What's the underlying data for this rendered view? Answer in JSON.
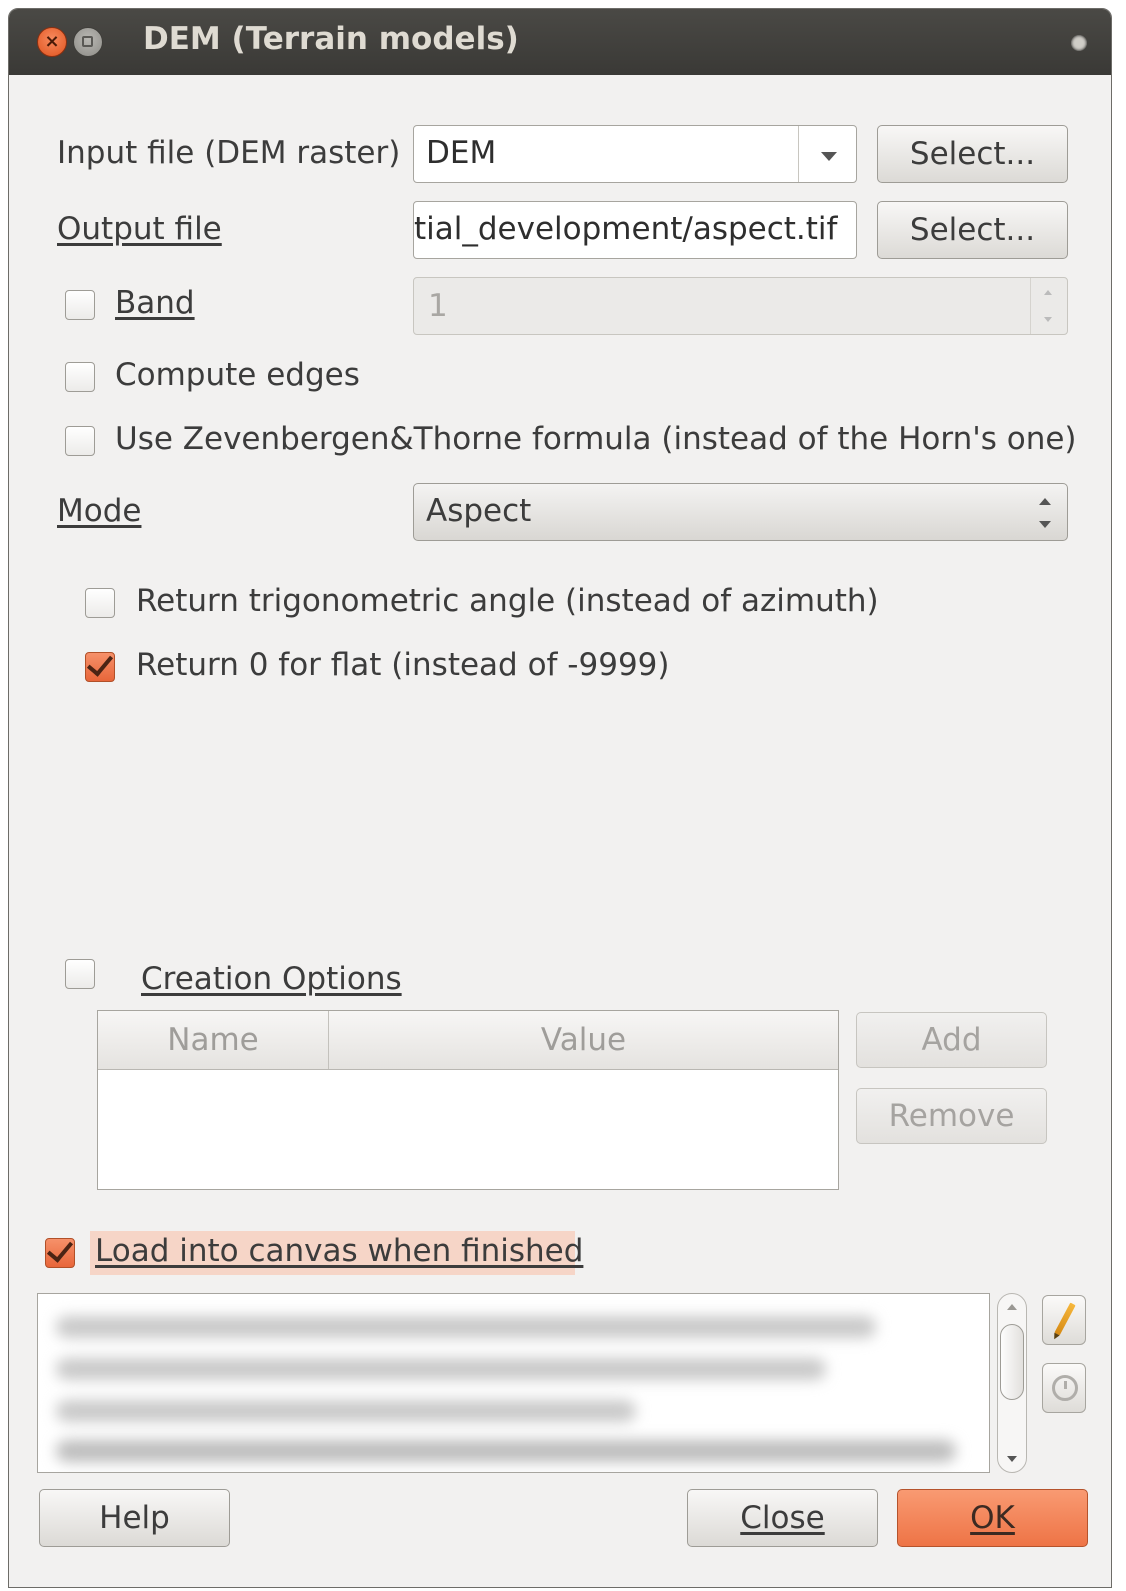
{
  "window": {
    "title": "DEM (Terrain models)",
    "close_glyph": "×"
  },
  "input_file": {
    "label": "Input file (DEM raster)",
    "value": "DEM",
    "select_label": "Select..."
  },
  "output_file": {
    "label": "Output file",
    "value": "tial_development/aspect.tif",
    "select_label": "Select..."
  },
  "band": {
    "label": "Band",
    "checked": false,
    "value": "1"
  },
  "compute_edges": {
    "label": "Compute edges",
    "checked": false
  },
  "zevenbergen": {
    "label": "Use Zevenbergen&Thorne formula (instead of the Horn's one)",
    "checked": false
  },
  "mode": {
    "label": "Mode",
    "value": "Aspect"
  },
  "trig_angle": {
    "label": "Return trigonometric angle (instead of azimuth)",
    "checked": false
  },
  "zero_flat": {
    "label": "Return 0 for flat (instead of -9999)",
    "checked": true
  },
  "creation_options": {
    "label": "Creation Options",
    "checked": false,
    "columns": [
      "Name",
      "Value"
    ],
    "add_label": "Add",
    "remove_label": "Remove"
  },
  "load_canvas": {
    "label": "Load into canvas when finished",
    "checked": true
  },
  "footer": {
    "help_label": "Help",
    "close_label": "Close",
    "ok_label": "OK"
  },
  "icons": {
    "edit": "pencil-icon",
    "reset": "clock-icon"
  },
  "colors": {
    "accent": "#ee7446",
    "titlebar": "#3f3e3a",
    "dialog_bg": "#f2f1f0"
  }
}
